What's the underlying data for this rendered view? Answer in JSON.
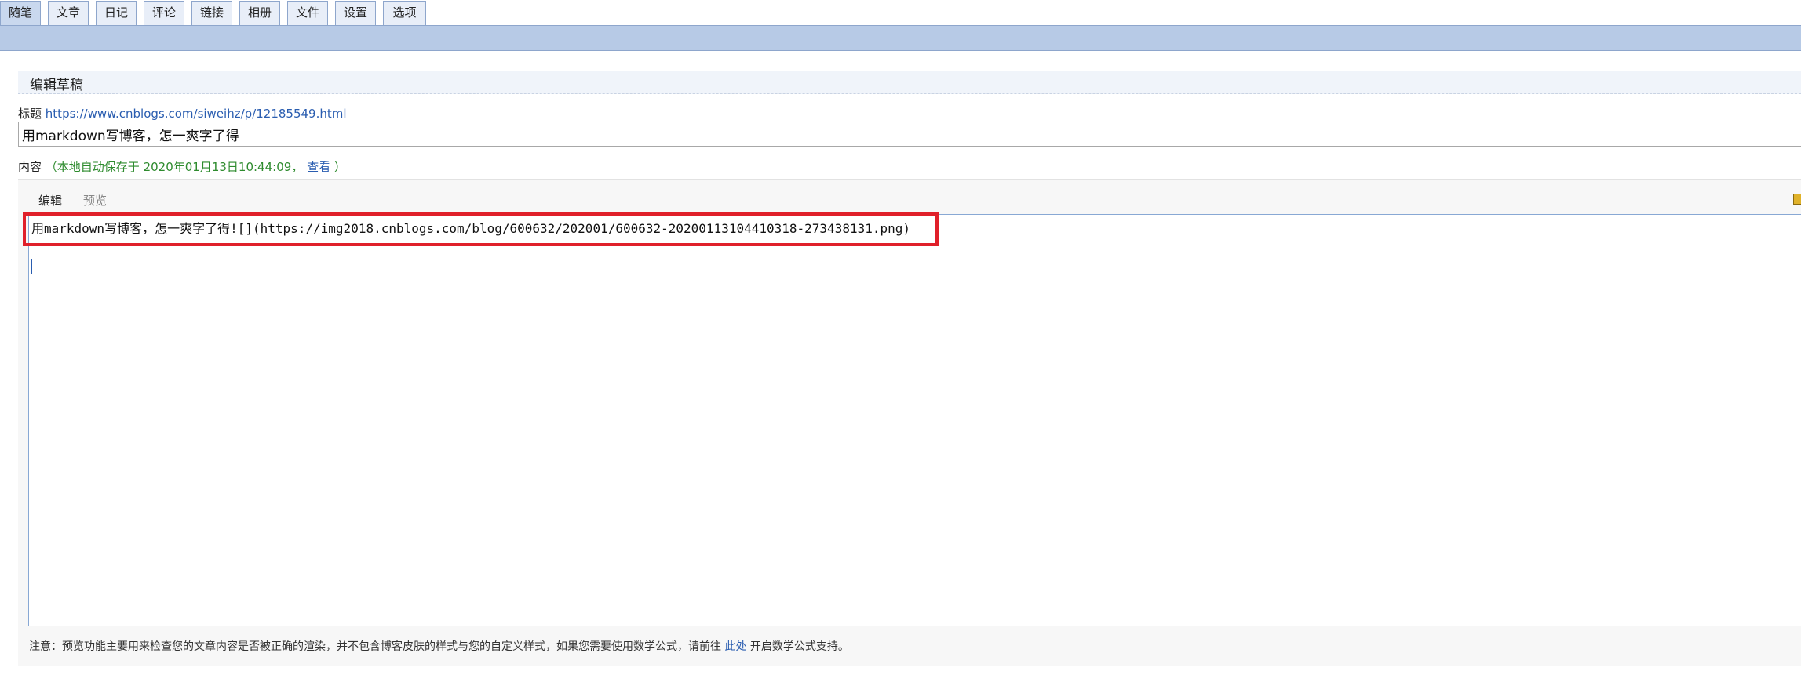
{
  "tabs": [
    {
      "label": "随笔",
      "active": true
    },
    {
      "label": "文章",
      "active": false
    },
    {
      "label": "日记",
      "active": false
    },
    {
      "label": "评论",
      "active": false
    },
    {
      "label": "链接",
      "active": false
    },
    {
      "label": "相册",
      "active": false
    },
    {
      "label": "文件",
      "active": false
    },
    {
      "label": "设置",
      "active": false
    },
    {
      "label": "选项",
      "active": false
    }
  ],
  "section": {
    "title": "编辑草稿"
  },
  "title_field": {
    "label": "标题",
    "url": "https://www.cnblogs.com/siweihz/p/12185549.html",
    "value": "用markdown写博客，怎一爽字了得"
  },
  "content": {
    "label": "内容",
    "autosave_text": "（本地自动保存于 2020年01月13日10:44:09，",
    "view_link": "查看",
    "close_paren": "）"
  },
  "editor": {
    "tab_edit": "编辑",
    "tab_preview": "预览",
    "line1": "用markdown写博客，怎一爽字了得![](https://img2018.cnblogs.com/blog/600632/202001/600632-20200113104410318-273438131.png)"
  },
  "note": {
    "text": "注意：预览功能主要用来检查您的文章内容是否被正确的渲染，并不包含博客皮肤的样式与您的自定义样式，如果您需要使用数学公式，请前往 ",
    "link": "此处",
    "suffix": " 开启数学公式支持。"
  },
  "colors": {
    "accent_blue": "#b7cae6",
    "highlight_red": "#e0202a",
    "link_blue": "#2a5db0",
    "autosave_green": "#2e8b2e"
  }
}
